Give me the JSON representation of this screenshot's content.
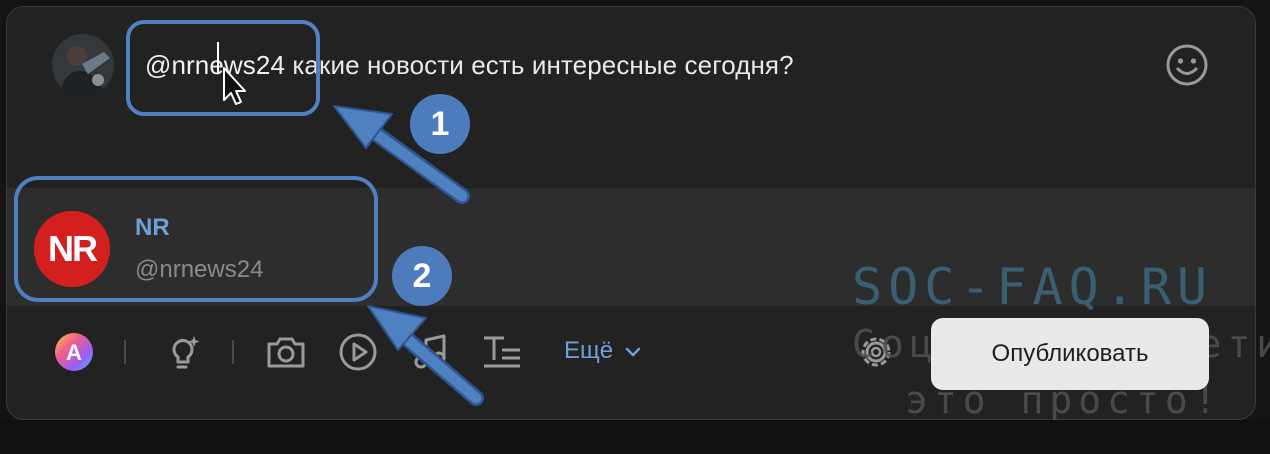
{
  "composer": {
    "mention": "@nrnews24",
    "text": "какие новости есть интересные сегодня?"
  },
  "suggestion": {
    "name": "NR",
    "handle": "@nrnews24",
    "avatar_text": "NR"
  },
  "toolbar": {
    "more_label": "Ещё",
    "publish_label": "Опубликовать"
  },
  "annotations": {
    "badge_1": "1",
    "badge_2": "2"
  },
  "watermark": {
    "line1": "SOC-FAQ.RU",
    "line2": "Социальные сети",
    "line3": "это просто!"
  },
  "colors": {
    "accent_blue": "#6fa0d8",
    "annotation_blue": "#4f80bf",
    "nr_red": "#d41f1f"
  }
}
